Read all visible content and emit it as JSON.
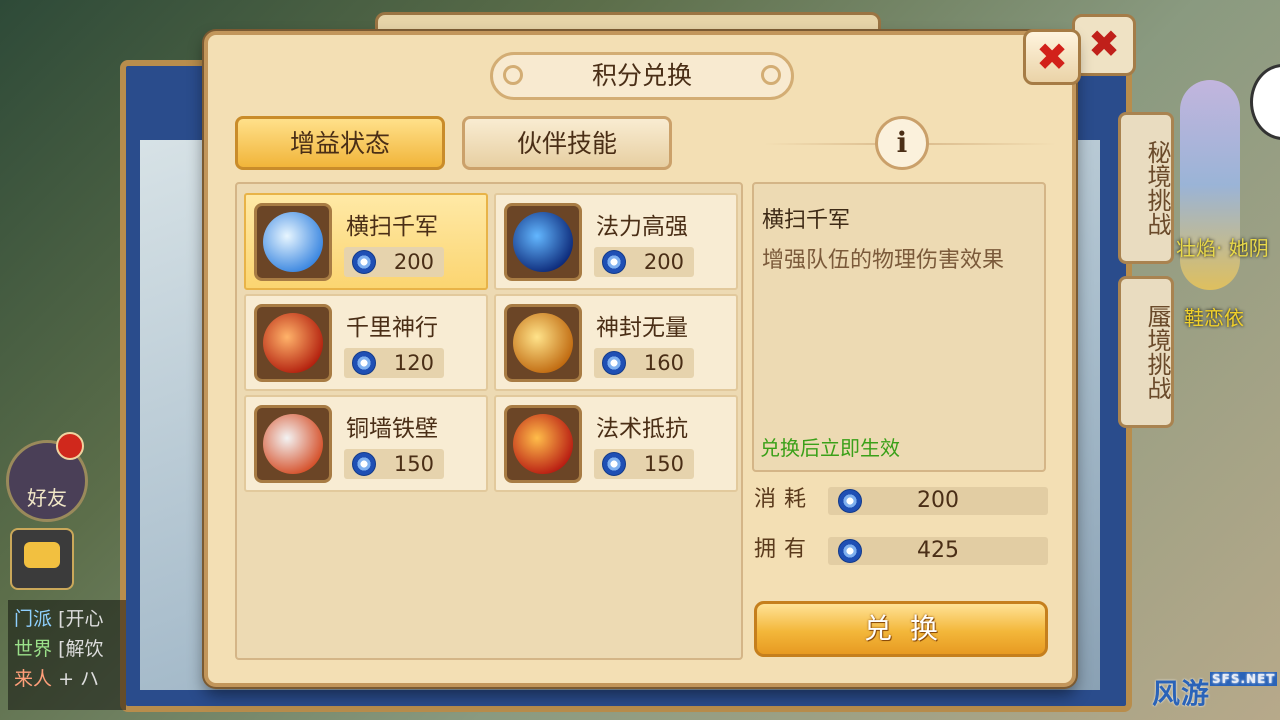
{
  "background": {
    "side_tabs": [
      "秘境挑战",
      "蜃境挑战"
    ],
    "friend_label": "好友",
    "chat_lines": [
      {
        "channel": "门派",
        "text": "[开心"
      },
      {
        "channel": "世界",
        "text": "[解饮"
      },
      {
        "channel": "来人",
        "text": "+ ハ"
      }
    ],
    "char_name_1": "壮焰· 她阴",
    "char_name_2": "鞋恋依",
    "watermark": "风游",
    "watermark_small": "SFS.NET"
  },
  "dialog": {
    "title": "积分兑换",
    "close_icon": "✖",
    "tabs": [
      {
        "label": "增益状态",
        "active": true
      },
      {
        "label": "伙伴技能",
        "active": false
      }
    ],
    "info_icon": "i"
  },
  "items": [
    {
      "name": "横扫千军",
      "cost": "200",
      "icon": "whirlwind-sword-icon",
      "colors": [
        "#e8f6ff",
        "#3a86e0"
      ],
      "selected": true
    },
    {
      "name": "法力高强",
      "cost": "200",
      "icon": "blue-skull-icon",
      "colors": [
        "#63b7ff",
        "#0d2a7a"
      ],
      "selected": false
    },
    {
      "name": "千里神行",
      "cost": "120",
      "icon": "red-phoenix-icon",
      "colors": [
        "#ffb36a",
        "#b3200e"
      ],
      "selected": false
    },
    {
      "name": "神封无量",
      "cost": "160",
      "icon": "golden-ring-icon",
      "colors": [
        "#ffe38a",
        "#c06a10"
      ],
      "selected": false
    },
    {
      "name": "铜墙铁壁",
      "cost": "150",
      "icon": "shield-icon",
      "colors": [
        "#f3f3f3",
        "#d5502a"
      ],
      "selected": false
    },
    {
      "name": "法术抵抗",
      "cost": "150",
      "icon": "red-demon-icon",
      "colors": [
        "#ffbd4a",
        "#b81c12"
      ],
      "selected": false
    }
  ],
  "detail": {
    "name": "横扫千军",
    "description": "增强队伍的物理伤害效果",
    "note": "兑换后立即生效",
    "consume_label": "消耗",
    "consume_value": "200",
    "own_label": "拥有",
    "own_value": "425"
  },
  "exchange_button": "兑换",
  "colors": {
    "panel": "#f3dfb4",
    "accent": "#f1b53a",
    "note_green": "#3aa018",
    "close_red": "#d2211a"
  }
}
